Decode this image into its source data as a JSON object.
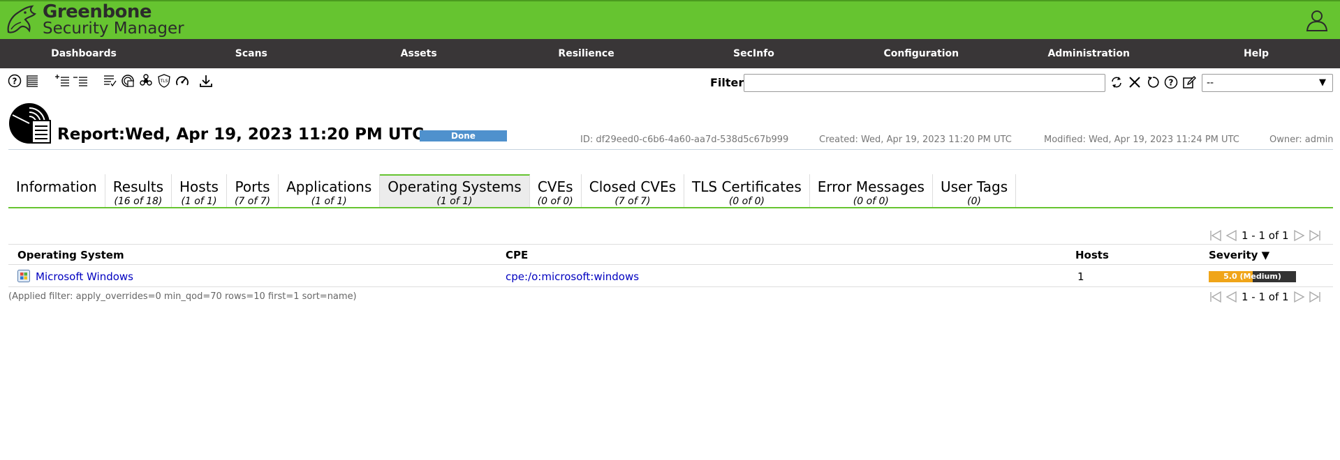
{
  "header": {
    "brand_line1": "Greenbone",
    "brand_line2": "Security Manager",
    "logo_icon": "greenbone-dragon-logo",
    "user_icon": "user-icon"
  },
  "nav": [
    "Dashboards",
    "Scans",
    "Assets",
    "Resilience",
    "SecInfo",
    "Configuration",
    "Administration",
    "Help"
  ],
  "toolbar": {
    "icons": [
      "help-icon",
      "list-icon",
      "add-list-icon",
      "remove-list-icon",
      "report-list-icon",
      "results-icon",
      "vulnerability-icon",
      "tls-shield-icon",
      "performance-icon",
      "download-icon"
    ]
  },
  "filter": {
    "label": "Filter",
    "value": "",
    "select_value": "--"
  },
  "report": {
    "title": "Report:Wed, Apr 19, 2023 11:20 PM UTC",
    "status": "Done",
    "id": "ID: df29eed0-c6b6-4a60-aa7d-538d5c67b999",
    "created": "Created: Wed, Apr 19, 2023 11:20 PM UTC",
    "modified": "Modified: Wed, Apr 19, 2023 11:24 PM UTC",
    "owner": "Owner: admin"
  },
  "tabs": [
    {
      "label": "Information",
      "count": ""
    },
    {
      "label": "Results",
      "count": "(16 of 18)"
    },
    {
      "label": "Hosts",
      "count": "(1 of 1)"
    },
    {
      "label": "Ports",
      "count": "(7 of 7)"
    },
    {
      "label": "Applications",
      "count": "(1 of 1)"
    },
    {
      "label": "Operating Systems",
      "count": "(1 of 1)"
    },
    {
      "label": "CVEs",
      "count": "(0 of 0)"
    },
    {
      "label": "Closed CVEs",
      "count": "(7 of 7)"
    },
    {
      "label": "TLS Certificates",
      "count": "(0 of 0)"
    },
    {
      "label": "Error Messages",
      "count": "(0 of 0)"
    },
    {
      "label": "User Tags",
      "count": "(0)"
    }
  ],
  "pagination": {
    "text": "1 - 1 of 1"
  },
  "table": {
    "headers": {
      "os": "Operating System",
      "cpe": "CPE",
      "hosts": "Hosts",
      "severity": "Severity ▼"
    },
    "rows": [
      {
        "os": "Microsoft Windows",
        "cpe": "cpe:/o:microsoft:windows",
        "hosts": "1",
        "severity_label": "5.0 (Medium)",
        "severity_fraction": 0.5
      }
    ]
  },
  "applied_filter": "(Applied filter: apply_overrides=0 min_qod=70 rows=10 first=1 sort=name)",
  "colors": {
    "header_green": "#66c430",
    "nav_dark": "#393637",
    "status_blue": "#4f91cd",
    "severity_orange": "#f0a519"
  }
}
